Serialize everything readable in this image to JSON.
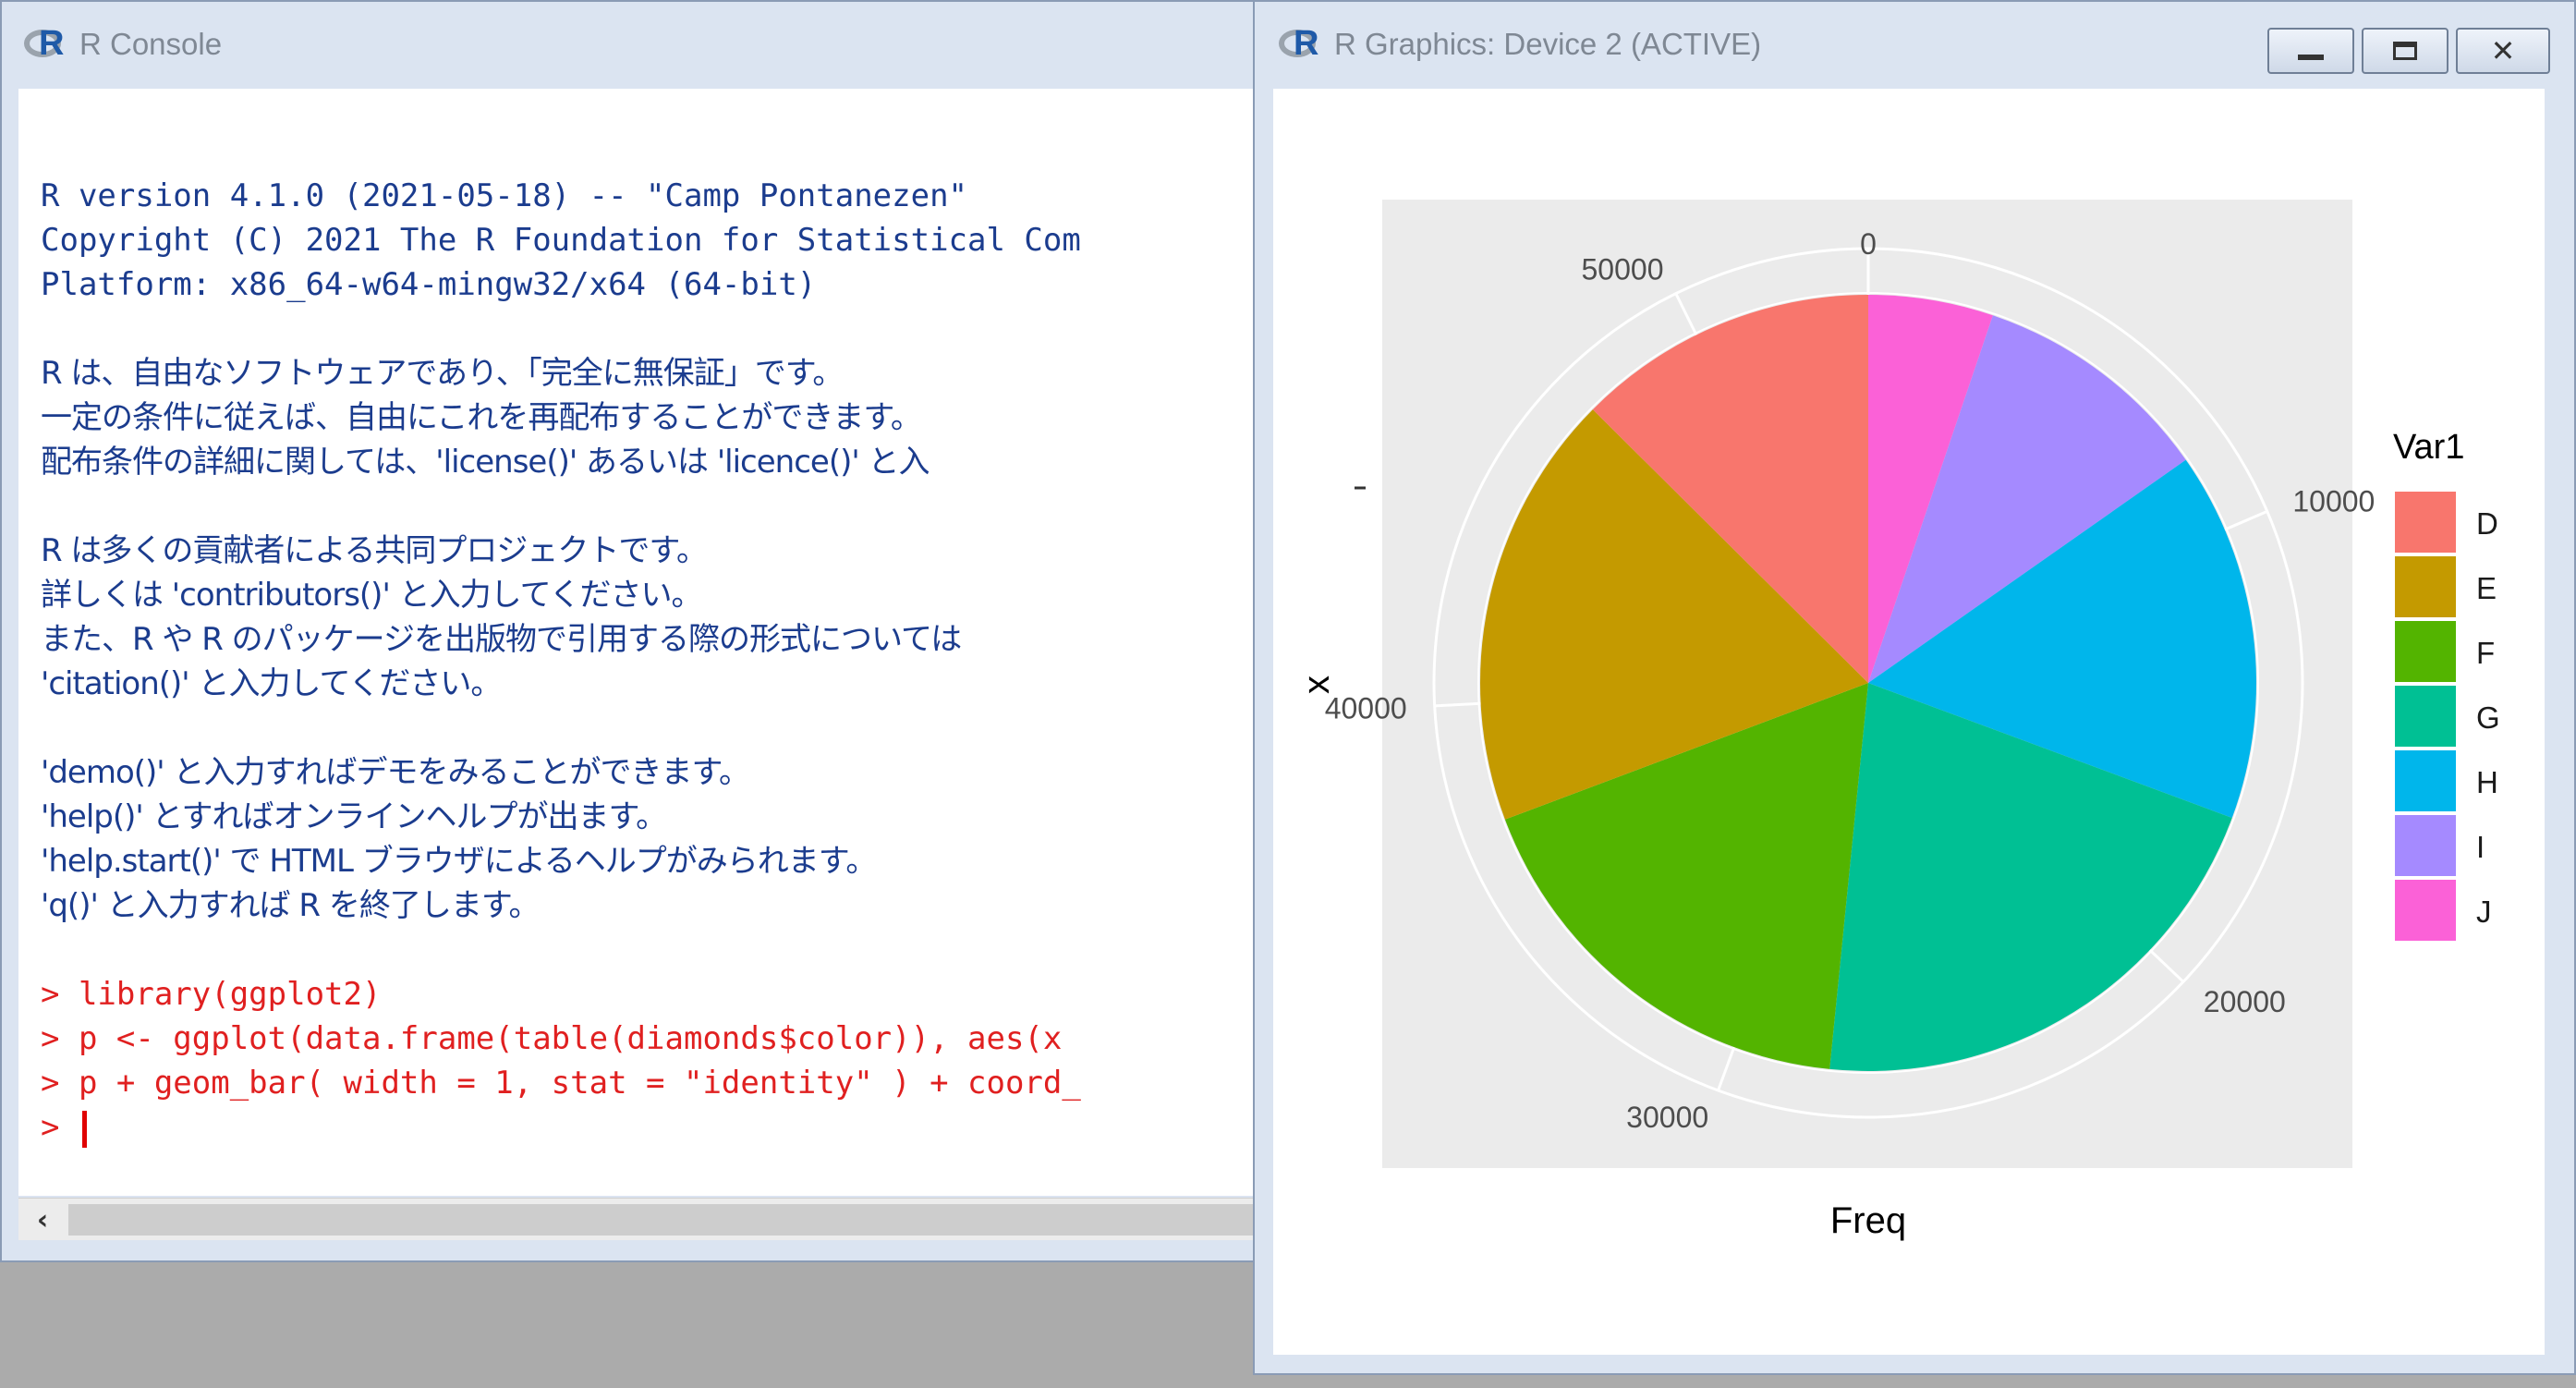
{
  "console": {
    "title": "R Console",
    "lines": [
      {
        "text": "R version 4.1.0 (2021-05-18) -- \"Camp Pontanezen\"",
        "kind": "out"
      },
      {
        "text": "Copyright (C) 2021 The R Foundation for Statistical Com",
        "kind": "out"
      },
      {
        "text": "Platform: x86_64-w64-mingw32/x64 (64-bit)",
        "kind": "out"
      },
      {
        "text": "",
        "kind": "blank"
      },
      {
        "text": "R は、自由なソフトウェアであり、「完全に無保証」です。",
        "kind": "jp"
      },
      {
        "text": "一定の条件に従えば、自由にこれを再配布することができます。",
        "kind": "jp"
      },
      {
        "text": "配布条件の詳細に関しては、'license()' あるいは 'licence()' と入",
        "kind": "jp"
      },
      {
        "text": "",
        "kind": "blank"
      },
      {
        "text": "R は多くの貢献者による共同プロジェクトです。",
        "kind": "jp"
      },
      {
        "text": "詳しくは 'contributors()' と入力してください。",
        "kind": "jp"
      },
      {
        "text": "また、R や R のパッケージを出版物で引用する際の形式については",
        "kind": "jp"
      },
      {
        "text": "'citation()' と入力してください。",
        "kind": "jp"
      },
      {
        "text": "",
        "kind": "blank"
      },
      {
        "text": "'demo()' と入力すればデモをみることができます。",
        "kind": "jp"
      },
      {
        "text": "'help()' とすればオンラインヘルプが出ます。",
        "kind": "jp"
      },
      {
        "text": "'help.start()' で HTML ブラウザによるヘルプがみられます。",
        "kind": "jp"
      },
      {
        "text": "'q()' と入力すれば R を終了します。",
        "kind": "jp"
      },
      {
        "text": "",
        "kind": "blank"
      },
      {
        "text": "> library(ggplot2)",
        "kind": "cmd"
      },
      {
        "text": "> p <- ggplot(data.frame(table(diamonds$color)), aes(x",
        "kind": "cmd"
      },
      {
        "text": "> p + geom_bar( width = 1, stat = \"identity\" ) + coord_",
        "kind": "cmd"
      }
    ],
    "prompt": "> ",
    "scroll_left_glyph": "‹"
  },
  "graphics": {
    "title": "R Graphics: Device 2 (ACTIVE)",
    "minimize_glyph": "",
    "close_glyph": "✕"
  },
  "chart_data": {
    "type": "pie",
    "categories": [
      "D",
      "E",
      "F",
      "G",
      "H",
      "I",
      "J"
    ],
    "values": [
      6775,
      9797,
      9542,
      11292,
      8304,
      5422,
      2808
    ],
    "xlabel": "Freq",
    "ylabel": "x",
    "legend_title": "Var1",
    "legend_position": "right",
    "colors": [
      "#F8766D",
      "#C49A00",
      "#53B400",
      "#00C094",
      "#00B6EB",
      "#A58AFF",
      "#FB61D7"
    ],
    "tick_values": [
      0,
      10000,
      20000,
      30000,
      40000,
      50000
    ],
    "tick_labels": [
      "0",
      "10000",
      "20000",
      "30000",
      "40000",
      "50000"
    ],
    "panel_background": "#EBEBEB",
    "grid": true
  }
}
